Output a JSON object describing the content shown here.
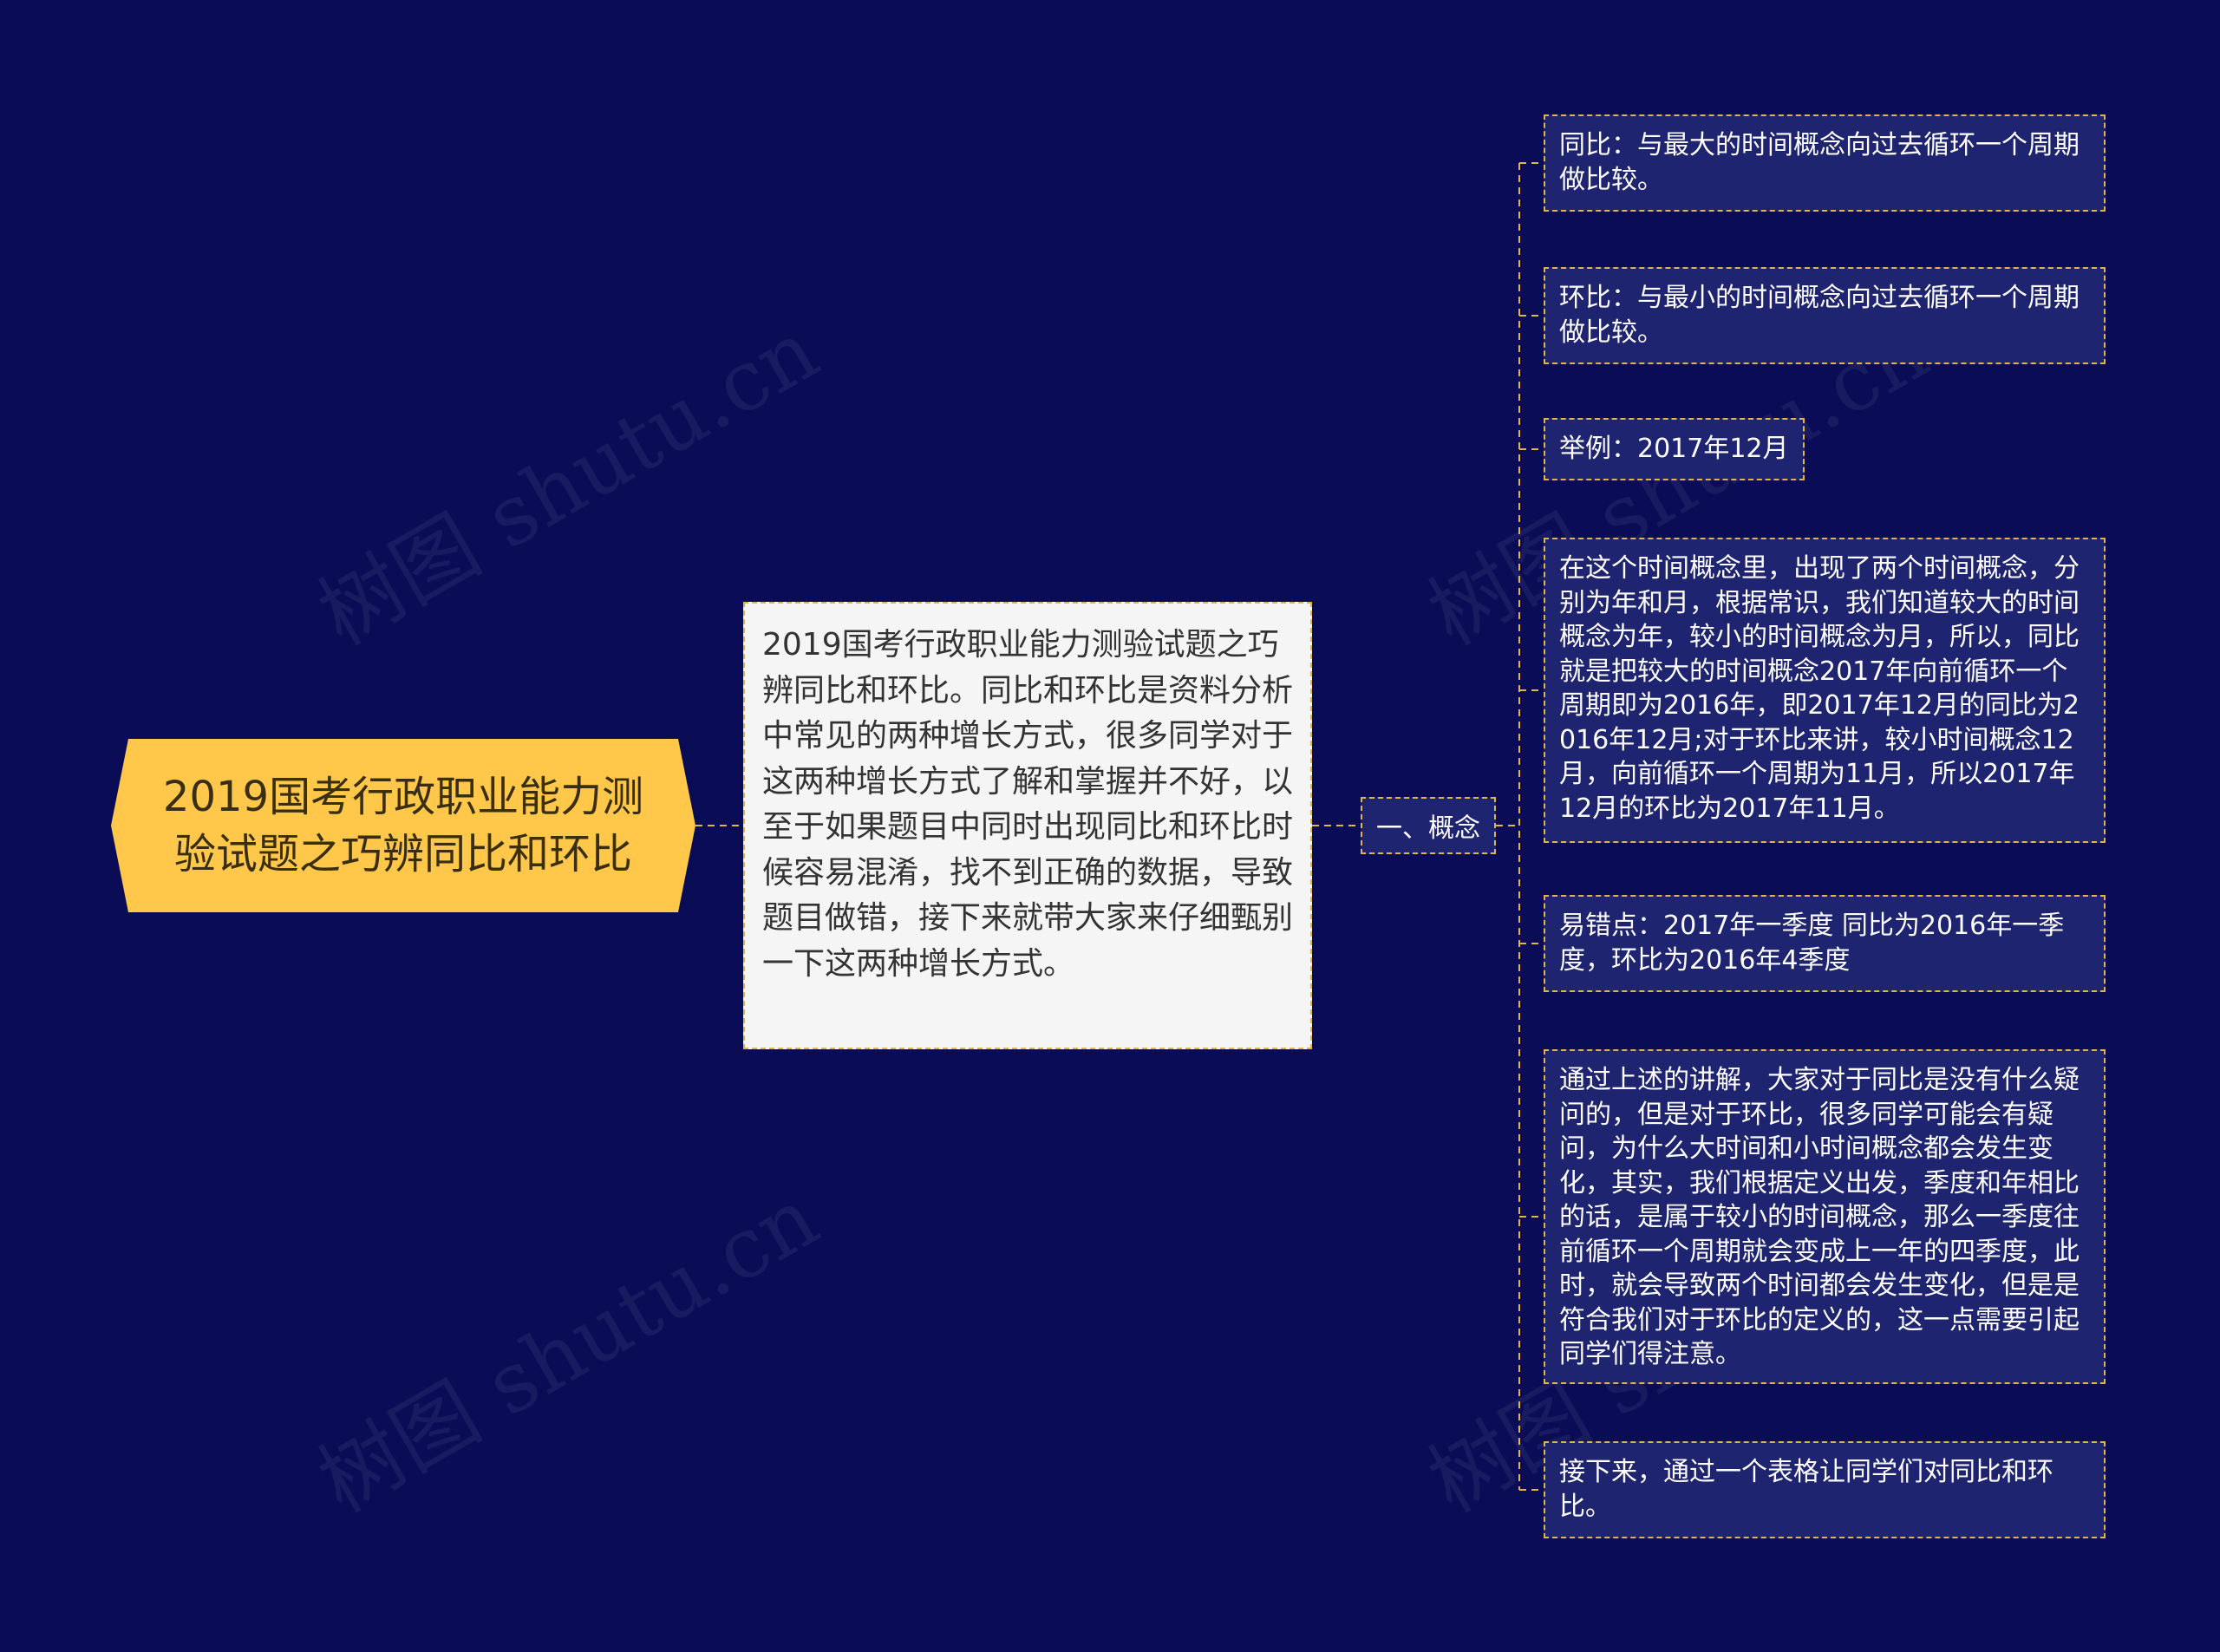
{
  "colors": {
    "background": "#0a0d55",
    "root_fill": "#ffc84a",
    "desc_fill": "#f5f5f5",
    "node_fill": "#1f2470",
    "connector": "#e0b64a"
  },
  "watermark": "树图 shutu.cn",
  "root": {
    "title": "2019国考行政职业能力测验试题之巧辨同比和环比"
  },
  "description": {
    "text": "2019国考行政职业能力测验试题之巧辨同比和环比。同比和环比是资料分析中常见的两种增长方式，很多同学对于这两种增长方式了解和掌握并不好，以至于如果题目中同时出现同比和环比时候容易混淆，找不到正确的数据，导致题目做错，接下来就带大家来仔细甄别一下这两种增长方式。"
  },
  "branch": {
    "label": "一、概念"
  },
  "leaves": [
    {
      "text": "同比：与最大的时间概念向过去循环一个周期做比较。"
    },
    {
      "text": "环比：与最小的时间概念向过去循环一个周期做比较。"
    },
    {
      "text": "举例：2017年12月"
    },
    {
      "text": "在这个时间概念里，出现了两个时间概念，分别为年和月，根据常识，我们知道较大的时间概念为年，较小的时间概念为月，所以，同比就是把较大的时间概念2017年向前循环一个周期即为2016年，即2017年12月的同比为2016年12月;对于环比来讲，较小时间概念12月，向前循环一个周期为11月，所以2017年12月的环比为2017年11月。"
    },
    {
      "text": "易错点：2017年一季度 同比为2016年一季度，环比为2016年4季度"
    },
    {
      "text": "通过上述的讲解，大家对于同比是没有什么疑问的，但是对于环比，很多同学可能会有疑问，为什么大时间和小时间概念都会发生变化，其实，我们根据定义出发，季度和年相比的话，是属于较小的时间概念，那么一季度往前循环一个周期就会变成上一年的四季度，此时，就会导致两个时间都会发生变化，但是是符合我们对于环比的定义的，这一点需要引起同学们得注意。"
    },
    {
      "text": "接下来，通过一个表格让同学们对同比和环比。"
    }
  ]
}
